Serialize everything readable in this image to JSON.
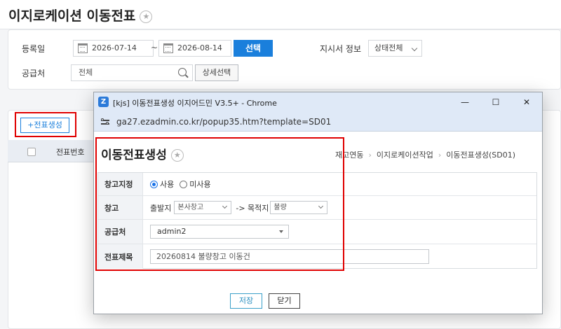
{
  "page": {
    "title": "이지로케이션 이동전표",
    "star_glyph": "★",
    "filters": {
      "date_label": "등록일",
      "start_date": "2026-07-14",
      "tilde": "~",
      "end_date": "2026-08-14",
      "select_button": "선택",
      "branch_label": "지시서 정보",
      "status_value": "상태전체",
      "supplier_label": "공급처",
      "supplier_value": "전체",
      "detail_button": "상세선택"
    },
    "list": {
      "create_button": "+전표생성",
      "column_slip_no": "전표번호"
    }
  },
  "window": {
    "title": "[kjs] 이동전표생성 이지어드민 V3.5+ - Chrome",
    "app_icon_letter": "Z",
    "minimize_glyph": "—",
    "maximize_glyph": "☐",
    "close_glyph": "✕",
    "url": "ga27.ezadmin.co.kr/popup35.htm?template=SD01"
  },
  "popup": {
    "title": "이동전표생성",
    "star_glyph": "★",
    "breadcrumb": [
      "재고연동",
      "이지로케이션작업",
      "이동전표생성(SD01)"
    ],
    "breadcrumb_sep": "›",
    "form": {
      "warehouse_assign_label": "창고지정",
      "radio_use": "사용",
      "radio_unused": "미사용",
      "radio_selected": "사용",
      "warehouse_label": "창고",
      "origin_label": "출발지",
      "origin_value": "본사창고",
      "arrow_dest_label": "-> 목적지",
      "dest_value": "불량",
      "supplier_label": "공급처",
      "supplier_value": "admin2",
      "slip_title_label": "전표제목",
      "slip_title_value": "20260814 불량창고 이동건"
    },
    "save_button": "저장",
    "close_button": "닫기"
  },
  "colors": {
    "accent": "#1a7fdc",
    "highlight_box": "#e00000"
  }
}
